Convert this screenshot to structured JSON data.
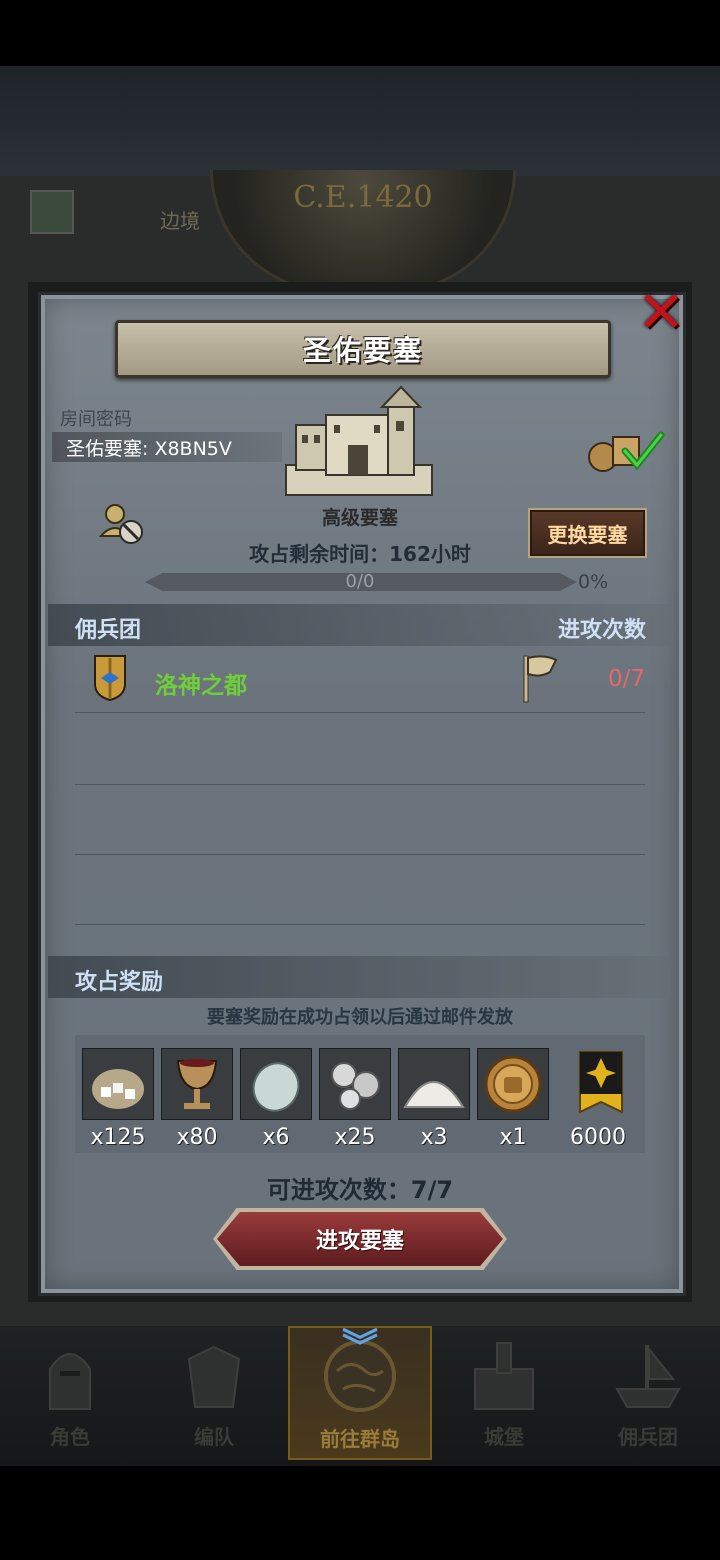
{
  "background": {
    "era": "C.E.1420",
    "tab_hint": "边境"
  },
  "modal": {
    "title": "圣佑要塞",
    "room_label": "房间密码",
    "room_code": "圣佑要塞: X8BN5V",
    "fortress_level": "高级要塞",
    "change_button": "更换要塞",
    "remaining_time": "攻占剩余时间：162小时",
    "progress_text": "0/0",
    "progress_percent": "0%",
    "progress_value": 0,
    "guild_header": "佣兵团",
    "attack_count_header": "进攻次数",
    "guild": {
      "name": "洛神之都",
      "attacks": "0/7",
      "shield_icon": "eagle-shield-icon",
      "flag_icon": "flag-icon"
    },
    "rewards_header": "攻占奖励",
    "rewards_note": "要塞奖励在成功占领以后通过邮件发放",
    "rewards": [
      {
        "icon": "sugar-sack-icon",
        "qty": "x125"
      },
      {
        "icon": "goblet-icon",
        "qty": "x80"
      },
      {
        "icon": "gem-stone-icon",
        "qty": "x6"
      },
      {
        "icon": "silver-ore-icon",
        "qty": "x25"
      },
      {
        "icon": "salt-pile-icon",
        "qty": "x3"
      },
      {
        "icon": "knight-medal-icon",
        "qty": "x1"
      },
      {
        "icon": "banner-icon",
        "qty": "6000"
      }
    ],
    "attempts": "可进攻次数：7/7",
    "attack_button": "进攻要塞"
  },
  "nav": [
    {
      "label": "角色",
      "icon": "knight-helmet-icon"
    },
    {
      "label": "编队",
      "icon": "armor-icon"
    },
    {
      "label": "前往群岛",
      "icon": "globe-icon"
    },
    {
      "label": "城堡",
      "icon": "castle-icon"
    },
    {
      "label": "佣兵团",
      "icon": "ship-icon"
    }
  ],
  "colors": {
    "guild_name": "#6fcf38",
    "attack_count": "#e06a6a",
    "close": "#c0141c",
    "accent_gold": "#b59a55"
  }
}
